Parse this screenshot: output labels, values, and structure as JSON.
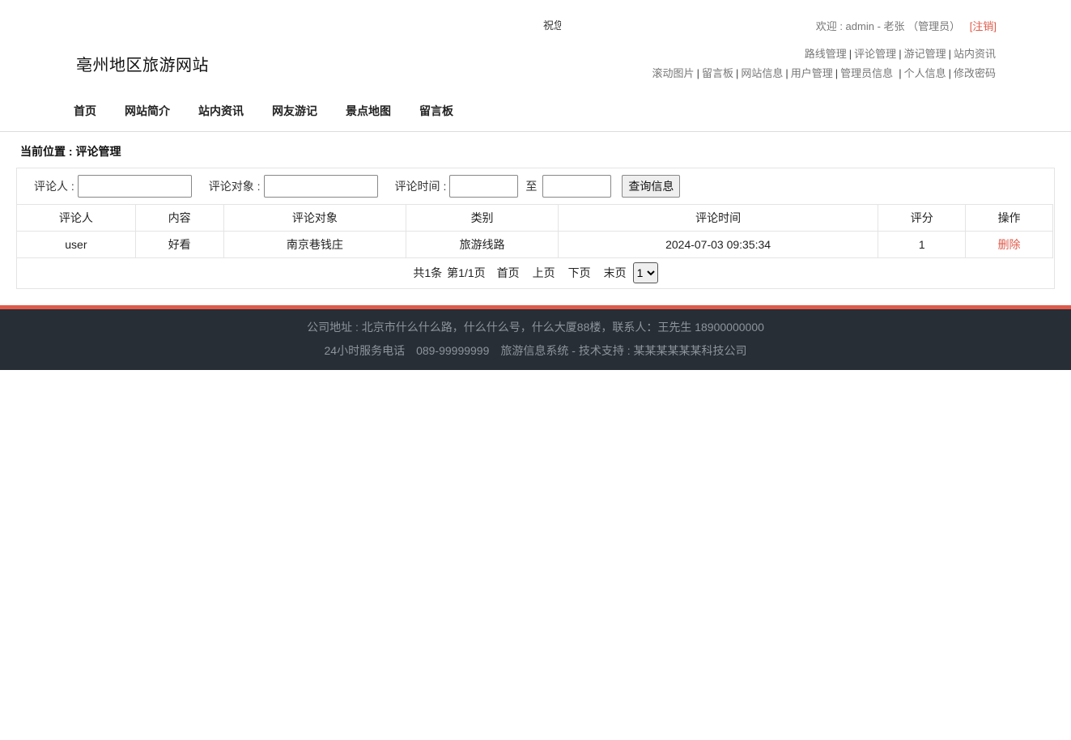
{
  "marquee": "祝您",
  "header": {
    "welcome_prefix": "欢迎 : admin - 老张 （管理员）",
    "logout": "[注销]",
    "site_title": "亳州地区旅游网站"
  },
  "admin_links": {
    "row1": [
      "路线管理",
      "评论管理",
      "游记管理",
      "站内资讯"
    ],
    "row2": [
      "滚动图片",
      "留言板",
      "网站信息",
      "用户管理",
      "管理员信息",
      "个人信息",
      "修改密码"
    ]
  },
  "nav": [
    "首页",
    "网站简介",
    "站内资讯",
    "网友游记",
    "景点地图",
    "留言板"
  ],
  "breadcrumb": "当前位置 : 评论管理",
  "search": {
    "commenter_label": "评论人 :",
    "commenter_value": "",
    "target_label": "评论对象 :",
    "target_value": "",
    "time_label": "评论时间 :",
    "time_from": "",
    "to_label": "至",
    "time_to": "",
    "button": "查询信息"
  },
  "table": {
    "headers": [
      "评论人",
      "内容",
      "评论对象",
      "类别",
      "评论时间",
      "评分",
      "操作"
    ],
    "rows": [
      [
        "user",
        "好看",
        "南京巷钱庄",
        "旅游线路",
        "2024-07-03 09:35:34",
        "1",
        "删除"
      ]
    ]
  },
  "pager": {
    "total": "共1条",
    "page": "第1/1页",
    "first": "首页",
    "prev": "上页",
    "next": "下页",
    "last": "末页",
    "selected": "1"
  },
  "footer": {
    "line1": "公司地址 : 北京市什么什么路，什么什么号，什么大厦88楼，联系人：王先生 18900000000",
    "line2": "24小时服务电话　089-99999999　旅游信息系统 - 技术支持 : 某某某某某某科技公司"
  },
  "colors": {
    "accent": "#e05a4a",
    "footer_bg": "#272e36"
  }
}
